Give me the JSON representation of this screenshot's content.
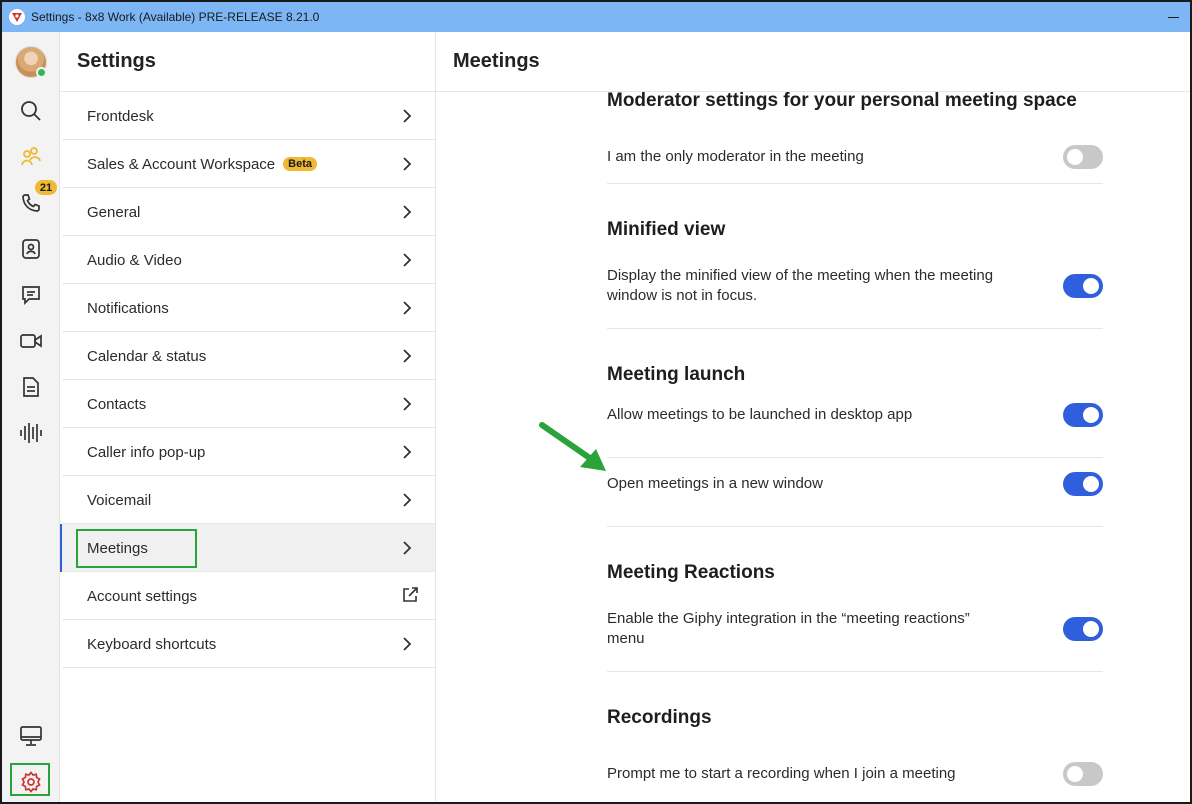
{
  "window": {
    "title": "Settings - 8x8 Work (Available) PRE-RELEASE 8.21.0"
  },
  "rail": {
    "calls_badge": "21",
    "icons": [
      "avatar",
      "search-icon",
      "spaces-icon",
      "phone-icon",
      "contacts-icon",
      "chat-icon",
      "video-icon",
      "document-icon",
      "voice-waveform-icon",
      "monitor-icon",
      "gear-icon"
    ],
    "accent_color": "#f0b933",
    "settings_color": "#d0342c"
  },
  "menu": {
    "title": "Settings",
    "items": [
      {
        "label": "Frontdesk",
        "trailing": "chevron"
      },
      {
        "label": "Sales & Account Workspace",
        "badge": "Beta",
        "trailing": "chevron"
      },
      {
        "label": "General",
        "trailing": "chevron"
      },
      {
        "label": "Audio & Video",
        "trailing": "chevron"
      },
      {
        "label": "Notifications",
        "trailing": "chevron"
      },
      {
        "label": "Calendar & status",
        "trailing": "chevron"
      },
      {
        "label": "Contacts",
        "trailing": "chevron"
      },
      {
        "label": "Caller info pop-up",
        "trailing": "chevron"
      },
      {
        "label": "Voicemail",
        "trailing": "chevron"
      },
      {
        "label": "Meetings",
        "trailing": "chevron",
        "selected": true
      },
      {
        "label": "Account settings",
        "trailing": "external-link"
      },
      {
        "label": "Keyboard shortcuts",
        "trailing": "chevron"
      }
    ]
  },
  "content": {
    "title": "Meetings",
    "sections": [
      {
        "title": "Moderator settings for your personal meeting space",
        "rows": [
          {
            "label": "I am the only moderator in the meeting",
            "enabled": false
          }
        ]
      },
      {
        "title": "Minified view",
        "rows": [
          {
            "label": "Display the minified view of the meeting when the meeting window is not in focus.",
            "enabled": true
          }
        ]
      },
      {
        "title": "Meeting launch",
        "rows": [
          {
            "label": "Allow meetings to be launched in desktop app",
            "enabled": true
          },
          {
            "label": "Open meetings in a new window",
            "enabled": true
          }
        ]
      },
      {
        "title": "Meeting Reactions",
        "rows": [
          {
            "label": "Enable the Giphy integration in the “meeting reactions” menu",
            "enabled": true
          }
        ]
      },
      {
        "title": "Recordings",
        "rows": [
          {
            "label": "Prompt me to start a recording when I join a meeting",
            "enabled": false
          }
        ]
      }
    ],
    "toggle_on_color": "#2f5fdc",
    "toggle_off_color": "#c8c8c8",
    "annotation_color": "#2aa33a"
  }
}
